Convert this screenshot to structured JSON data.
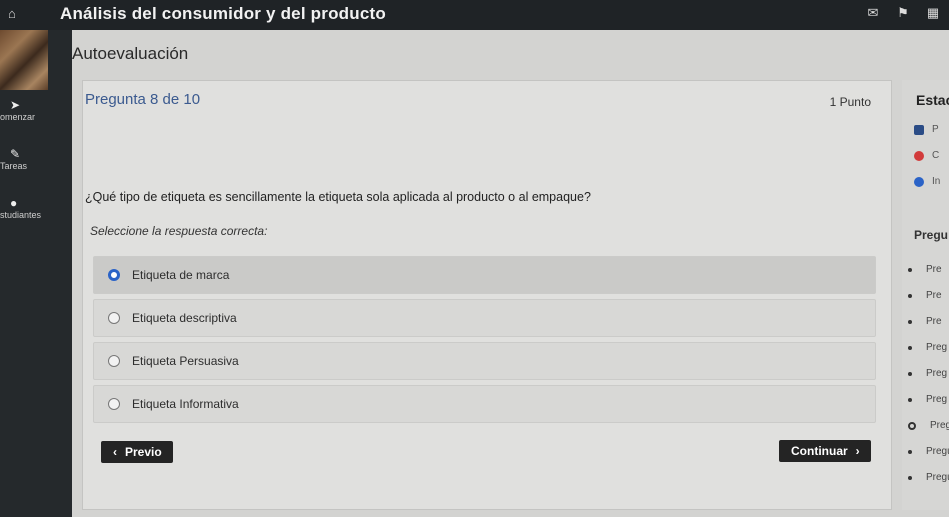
{
  "topbar": {
    "title": "Análisis del consumidor y del producto",
    "icons": [
      "home-icon",
      "mail-icon",
      "bell-icon",
      "calendar-icon"
    ]
  },
  "sidebar": {
    "items": [
      {
        "label": "omenzar",
        "icon": "navigate-icon"
      },
      {
        "label": "Tareas",
        "icon": "edit-icon"
      },
      {
        "label": "studiantes",
        "icon": "person-icon"
      }
    ]
  },
  "page": {
    "title": "Autoevaluación"
  },
  "question": {
    "header": "Pregunta 8 de 10",
    "points": "1 Punto",
    "text": "¿Qué tipo de etiqueta es sencillamente la etiqueta sola aplicada al producto o al empaque?",
    "instruction": "Seleccione la respuesta correcta:",
    "options": [
      {
        "label": "Etiqueta de marca",
        "selected": true
      },
      {
        "label": "Etiqueta descriptiva",
        "selected": false
      },
      {
        "label": "Etiqueta Persuasiva",
        "selected": false
      },
      {
        "label": "Etiqueta Informativa",
        "selected": false
      }
    ],
    "prev_label": "Previo",
    "next_label": "Continuar"
  },
  "right_panel": {
    "header": "Estac",
    "status_items": [
      {
        "label": "P",
        "color": "#2b4c86"
      },
      {
        "label": "C",
        "color": "#d23b3b"
      },
      {
        "label": "In",
        "color": "#2b63c7"
      }
    ],
    "subheader": "Pregu",
    "questions": [
      "Pre",
      "Pre",
      "Pre",
      "Preg",
      "Preg",
      "Preg",
      "Preg",
      "Pregu",
      "Pregu"
    ],
    "current_index": 6
  }
}
